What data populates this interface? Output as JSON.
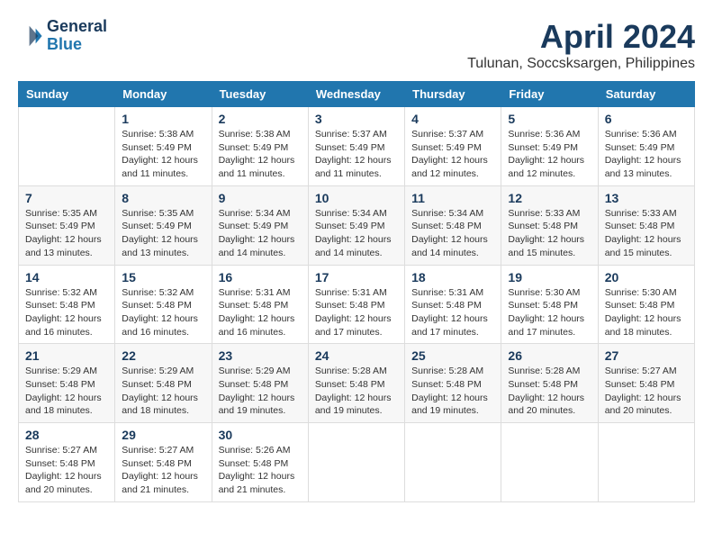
{
  "header": {
    "logo_line1": "General",
    "logo_line2": "Blue",
    "title": "April 2024",
    "subtitle": "Tulunan, Soccsksargen, Philippines"
  },
  "days_of_week": [
    "Sunday",
    "Monday",
    "Tuesday",
    "Wednesday",
    "Thursday",
    "Friday",
    "Saturday"
  ],
  "weeks": [
    [
      {
        "num": "",
        "info": ""
      },
      {
        "num": "1",
        "info": "Sunrise: 5:38 AM\nSunset: 5:49 PM\nDaylight: 12 hours\nand 11 minutes."
      },
      {
        "num": "2",
        "info": "Sunrise: 5:38 AM\nSunset: 5:49 PM\nDaylight: 12 hours\nand 11 minutes."
      },
      {
        "num": "3",
        "info": "Sunrise: 5:37 AM\nSunset: 5:49 PM\nDaylight: 12 hours\nand 11 minutes."
      },
      {
        "num": "4",
        "info": "Sunrise: 5:37 AM\nSunset: 5:49 PM\nDaylight: 12 hours\nand 12 minutes."
      },
      {
        "num": "5",
        "info": "Sunrise: 5:36 AM\nSunset: 5:49 PM\nDaylight: 12 hours\nand 12 minutes."
      },
      {
        "num": "6",
        "info": "Sunrise: 5:36 AM\nSunset: 5:49 PM\nDaylight: 12 hours\nand 13 minutes."
      }
    ],
    [
      {
        "num": "7",
        "info": "Sunrise: 5:35 AM\nSunset: 5:49 PM\nDaylight: 12 hours\nand 13 minutes."
      },
      {
        "num": "8",
        "info": "Sunrise: 5:35 AM\nSunset: 5:49 PM\nDaylight: 12 hours\nand 13 minutes."
      },
      {
        "num": "9",
        "info": "Sunrise: 5:34 AM\nSunset: 5:49 PM\nDaylight: 12 hours\nand 14 minutes."
      },
      {
        "num": "10",
        "info": "Sunrise: 5:34 AM\nSunset: 5:49 PM\nDaylight: 12 hours\nand 14 minutes."
      },
      {
        "num": "11",
        "info": "Sunrise: 5:34 AM\nSunset: 5:48 PM\nDaylight: 12 hours\nand 14 minutes."
      },
      {
        "num": "12",
        "info": "Sunrise: 5:33 AM\nSunset: 5:48 PM\nDaylight: 12 hours\nand 15 minutes."
      },
      {
        "num": "13",
        "info": "Sunrise: 5:33 AM\nSunset: 5:48 PM\nDaylight: 12 hours\nand 15 minutes."
      }
    ],
    [
      {
        "num": "14",
        "info": "Sunrise: 5:32 AM\nSunset: 5:48 PM\nDaylight: 12 hours\nand 16 minutes."
      },
      {
        "num": "15",
        "info": "Sunrise: 5:32 AM\nSunset: 5:48 PM\nDaylight: 12 hours\nand 16 minutes."
      },
      {
        "num": "16",
        "info": "Sunrise: 5:31 AM\nSunset: 5:48 PM\nDaylight: 12 hours\nand 16 minutes."
      },
      {
        "num": "17",
        "info": "Sunrise: 5:31 AM\nSunset: 5:48 PM\nDaylight: 12 hours\nand 17 minutes."
      },
      {
        "num": "18",
        "info": "Sunrise: 5:31 AM\nSunset: 5:48 PM\nDaylight: 12 hours\nand 17 minutes."
      },
      {
        "num": "19",
        "info": "Sunrise: 5:30 AM\nSunset: 5:48 PM\nDaylight: 12 hours\nand 17 minutes."
      },
      {
        "num": "20",
        "info": "Sunrise: 5:30 AM\nSunset: 5:48 PM\nDaylight: 12 hours\nand 18 minutes."
      }
    ],
    [
      {
        "num": "21",
        "info": "Sunrise: 5:29 AM\nSunset: 5:48 PM\nDaylight: 12 hours\nand 18 minutes."
      },
      {
        "num": "22",
        "info": "Sunrise: 5:29 AM\nSunset: 5:48 PM\nDaylight: 12 hours\nand 18 minutes."
      },
      {
        "num": "23",
        "info": "Sunrise: 5:29 AM\nSunset: 5:48 PM\nDaylight: 12 hours\nand 19 minutes."
      },
      {
        "num": "24",
        "info": "Sunrise: 5:28 AM\nSunset: 5:48 PM\nDaylight: 12 hours\nand 19 minutes."
      },
      {
        "num": "25",
        "info": "Sunrise: 5:28 AM\nSunset: 5:48 PM\nDaylight: 12 hours\nand 19 minutes."
      },
      {
        "num": "26",
        "info": "Sunrise: 5:28 AM\nSunset: 5:48 PM\nDaylight: 12 hours\nand 20 minutes."
      },
      {
        "num": "27",
        "info": "Sunrise: 5:27 AM\nSunset: 5:48 PM\nDaylight: 12 hours\nand 20 minutes."
      }
    ],
    [
      {
        "num": "28",
        "info": "Sunrise: 5:27 AM\nSunset: 5:48 PM\nDaylight: 12 hours\nand 20 minutes."
      },
      {
        "num": "29",
        "info": "Sunrise: 5:27 AM\nSunset: 5:48 PM\nDaylight: 12 hours\nand 21 minutes."
      },
      {
        "num": "30",
        "info": "Sunrise: 5:26 AM\nSunset: 5:48 PM\nDaylight: 12 hours\nand 21 minutes."
      },
      {
        "num": "",
        "info": ""
      },
      {
        "num": "",
        "info": ""
      },
      {
        "num": "",
        "info": ""
      },
      {
        "num": "",
        "info": ""
      }
    ]
  ]
}
